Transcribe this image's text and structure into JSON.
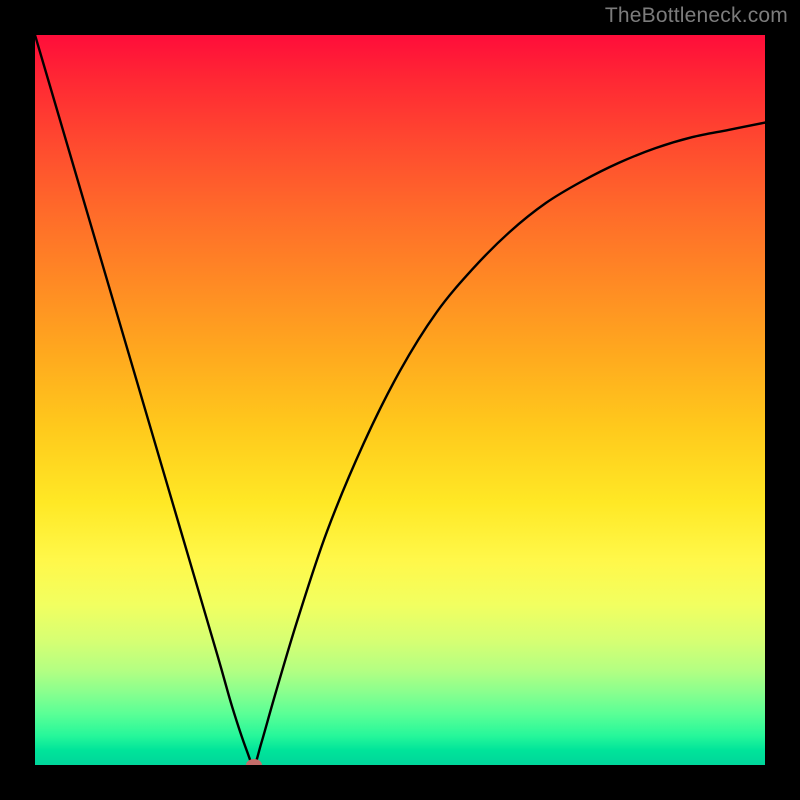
{
  "watermark": "TheBottleneck.com",
  "chart_data": {
    "type": "line",
    "title": "",
    "xlabel": "",
    "ylabel": "",
    "xlim": [
      0,
      100
    ],
    "ylim": [
      0,
      100
    ],
    "grid": false,
    "legend": false,
    "series": [
      {
        "name": "curve",
        "x": [
          0,
          5,
          10,
          15,
          20,
          25,
          27,
          29,
          30,
          31,
          33,
          36,
          40,
          45,
          50,
          55,
          60,
          65,
          70,
          75,
          80,
          85,
          90,
          95,
          100
        ],
        "y": [
          100,
          83,
          66,
          49,
          32,
          15,
          8,
          2,
          0,
          3,
          10,
          20,
          32,
          44,
          54,
          62,
          68,
          73,
          77,
          80,
          82.5,
          84.5,
          86,
          87,
          88
        ]
      }
    ],
    "marker": {
      "x": 30,
      "y": 0,
      "color": "#c46d6a"
    },
    "background_gradient": {
      "top": "#ff0d3a",
      "mid": "#ffe825",
      "bottom": "#00d69b"
    }
  }
}
